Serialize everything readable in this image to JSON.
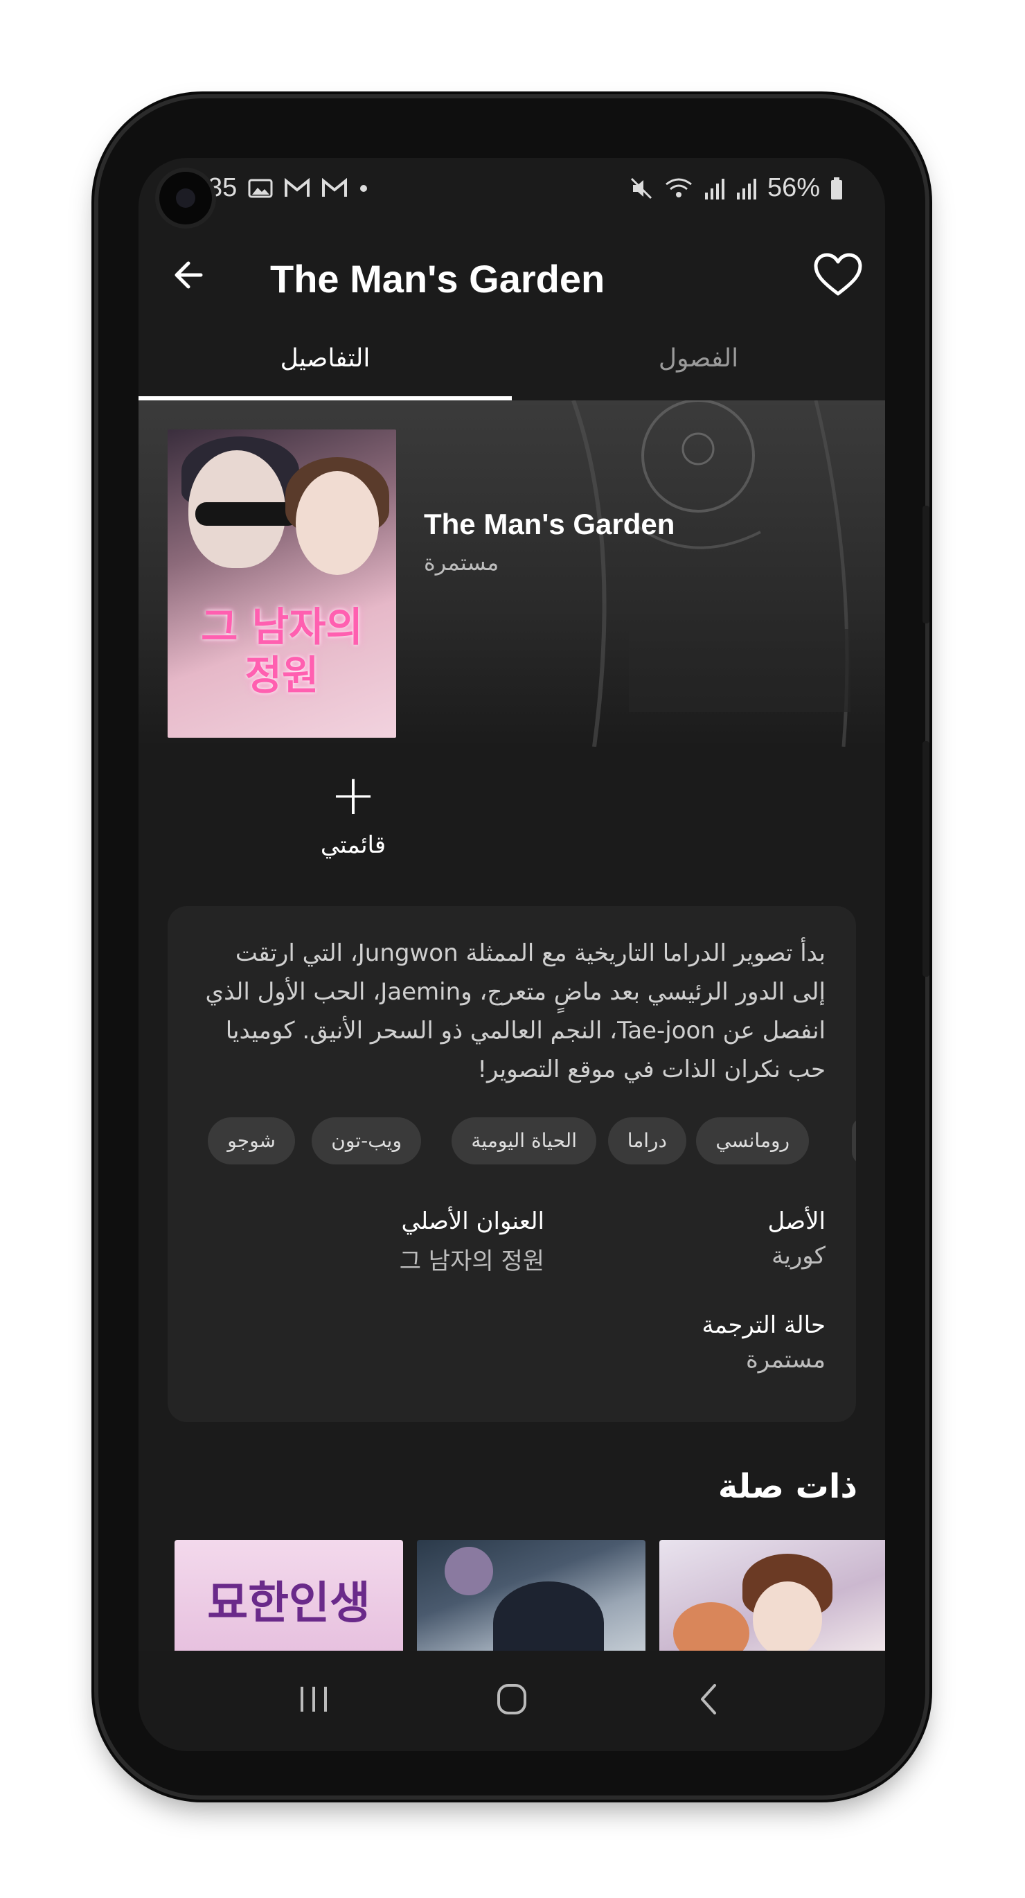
{
  "status_bar": {
    "time": "35",
    "battery": "56%"
  },
  "app_bar": {
    "title": "The Man's Garden"
  },
  "tabs": [
    {
      "label": "التفاصيل",
      "active": true
    },
    {
      "label": "الفصول",
      "active": false
    }
  ],
  "series": {
    "title": "The Man's Garden",
    "status": "مستمرة",
    "cover_logo": "그 남자의 정원"
  },
  "my_list": {
    "label": "قائمتي"
  },
  "description": "بدأ تصوير الدراما التاريخية مع الممثلة Jungwon، التي ارتقت إلى الدور الرئيسي بعد ماضٍ متعرج، وJaemin، الحب الأول الذي انفصل عن Tae-joon، النجم العالمي ذو السحر الأنيق. كوميديا حب نكران الذات في موقع التصوير!",
  "genres": [
    "رومانسي",
    "دراما",
    "الحياة اليومية",
    "ويب-تون",
    "شوجو"
  ],
  "meta": {
    "origin_label": "الأصل",
    "origin_value": "كورية",
    "original_title_label": "العنوان الأصلي",
    "original_title_value": "그 남자의 정원",
    "translation_label": "حالة الترجمة",
    "translation_value": "مستمرة"
  },
  "related": {
    "heading": "ذات صلة",
    "first_thumb_text": "묘한인생"
  },
  "colors": {
    "background": "#1b1b1b",
    "card": "#242424",
    "chip": "#3a3a3a",
    "tab_indicator": "#ffffff"
  }
}
